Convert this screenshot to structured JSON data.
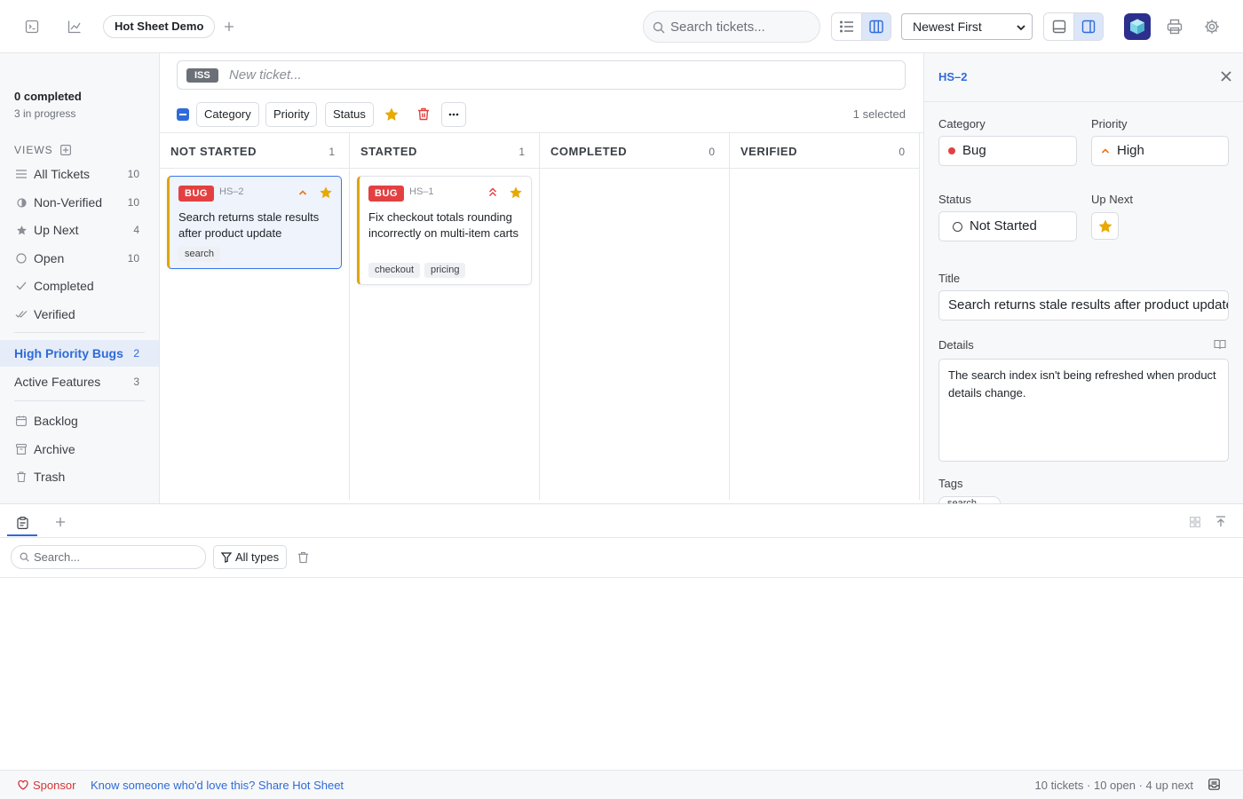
{
  "topbar": {
    "project_tab": "Hot Sheet Demo",
    "search_placeholder": "Search tickets...",
    "sort_value": "Newest First",
    "icons": [
      "terminal-icon",
      "chart-icon",
      "plus-icon",
      "list-view-icon",
      "columns-view-icon",
      "bottom-panel-icon",
      "side-panel-icon",
      "app-logo",
      "print-icon",
      "gear-icon"
    ]
  },
  "sidebar": {
    "completed": "0 completed",
    "in_progress": "3 in progress",
    "views_heading": "VIEWS",
    "views": [
      {
        "label": "All Tickets",
        "count": "10",
        "icon": "lines-icon"
      },
      {
        "label": "Non-Verified",
        "count": "10",
        "icon": "half-circle-icon"
      },
      {
        "label": "Up Next",
        "count": "4",
        "icon": "star-icon"
      },
      {
        "label": "Open",
        "count": "10",
        "icon": "circle-icon"
      },
      {
        "label": "Completed",
        "count": "",
        "icon": "check-icon"
      },
      {
        "label": "Verified",
        "count": "",
        "icon": "double-check-icon"
      }
    ],
    "custom_views": [
      {
        "label": "High Priority Bugs",
        "count": "2"
      },
      {
        "label": "Active Features",
        "count": "3"
      }
    ],
    "folders": [
      {
        "label": "Backlog",
        "icon": "calendar-icon"
      },
      {
        "label": "Archive",
        "icon": "archive-icon"
      },
      {
        "label": "Trash",
        "icon": "trash-icon"
      }
    ]
  },
  "main": {
    "new_ticket": {
      "type_badge": "ISS",
      "placeholder": "New ticket..."
    },
    "toolbar": {
      "category": "Category",
      "priority": "Priority",
      "status": "Status",
      "selected": "1 selected"
    },
    "columns": [
      {
        "title": "NOT STARTED",
        "count": "1"
      },
      {
        "title": "STARTED",
        "count": "1"
      },
      {
        "title": "COMPLETED",
        "count": "0"
      },
      {
        "title": "VERIFIED",
        "count": "0"
      }
    ],
    "cards": [
      {
        "badge": "BUG",
        "id": "HS–2",
        "title": "Search returns stale results after product update",
        "tags": [
          "search"
        ],
        "priority": "high"
      },
      {
        "badge": "BUG",
        "id": "HS–1",
        "title": "Fix checkout totals rounding incorrectly on multi-item carts",
        "tags": [
          "checkout",
          "pricing"
        ],
        "priority": "highest"
      }
    ]
  },
  "detail": {
    "id": "HS–2",
    "category_label": "Category",
    "category_value": "Bug",
    "priority_label": "Priority",
    "priority_value": "High",
    "status_label": "Status",
    "status_value": "Not Started",
    "upnext_label": "Up Next",
    "title_label": "Title",
    "title_value": "Search returns stale results after product update",
    "details_label": "Details",
    "details_value": "The search index isn't being refreshed when product details change.",
    "tags_label": "Tags",
    "first_tag": "search"
  },
  "bottom_panel": {
    "search_placeholder": "Search...",
    "filter_label": "All types"
  },
  "footer": {
    "sponsor": "Sponsor",
    "share": "Know someone who'd love this? Share Hot Sheet",
    "stats": "10 tickets · 10 open · 4 up next"
  },
  "colors": {
    "accent": "#2f6bd8",
    "bug": "#e34141",
    "star": "#e8a900",
    "priority_orange": "#e8741c"
  }
}
